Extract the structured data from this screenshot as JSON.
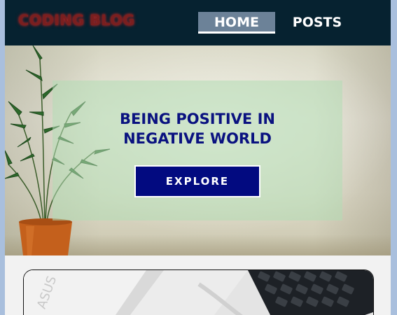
{
  "navbar": {
    "brand": "CODING BLOG",
    "links": [
      {
        "label": "HOME",
        "active": true
      },
      {
        "label": "POSTS",
        "active": false
      }
    ],
    "colors": {
      "background": "#062230",
      "brand": "#7a1f1f",
      "active_link_bg": "#6c8298"
    }
  },
  "hero": {
    "title": "BEING POSITIVE IN NEGATIVE WORLD",
    "button_label": "EXPLORE",
    "colors": {
      "title": "#0a1280",
      "button_bg": "#020a80",
      "overlay": "#b2dcb4"
    },
    "image": "potted-plant-icon"
  },
  "post_card": {
    "image": "laptop-keyboard-image",
    "laptop_brand": "ASUS"
  }
}
